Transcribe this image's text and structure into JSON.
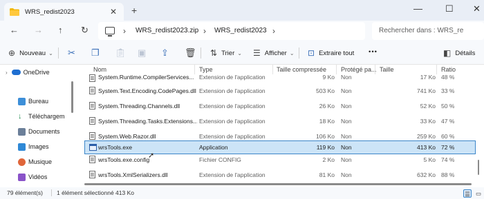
{
  "window": {
    "tab_title": "WRS_redist2023",
    "tab_close_glyph": "✕",
    "new_tab_glyph": "+",
    "minimize_glyph": "—",
    "maximize_glyph": "☐",
    "close_glyph": "✕"
  },
  "nav": {
    "back_glyph": "←",
    "forward_glyph": "→",
    "up_glyph": "↑",
    "refresh_glyph": "↻"
  },
  "address": {
    "breadcrumbs": [
      "WRS_redist2023.zip",
      "WRS_redist2023"
    ],
    "separator": "›"
  },
  "search": {
    "placeholder": "Rechercher dans : WRS_re"
  },
  "toolbar": {
    "new_label": "Nouveau",
    "sort_label": "Trier",
    "view_label": "Afficher",
    "extract_label": "Extraire tout",
    "more_glyph": "•••",
    "details_label": "Détails"
  },
  "sidebar": {
    "items": [
      {
        "label": "OneDrive",
        "icon": "cloud-icon"
      },
      {
        "label": "Bureau",
        "icon": "desktop-icon"
      },
      {
        "label": "Téléchargem",
        "icon": "download-icon"
      },
      {
        "label": "Documents",
        "icon": "documents-icon"
      },
      {
        "label": "Images",
        "icon": "pictures-icon"
      },
      {
        "label": "Musique",
        "icon": "music-icon"
      },
      {
        "label": "Vidéos",
        "icon": "videos-icon"
      }
    ]
  },
  "columns": [
    "Nom",
    "Type",
    "Taille compressée",
    "Protégé pa...",
    "Taille",
    "Ratio"
  ],
  "files": [
    {
      "name": "System.Runtime.CompilerServices...",
      "type": "Extension de l'application",
      "compressed": "9 Ko",
      "protected": "Non",
      "size": "17 Ko",
      "ratio": "48 %",
      "icon": "file-icon"
    },
    {
      "name": "System.Text.Encoding.CodePages.dll",
      "type": "Extension de l'application",
      "compressed": "503 Ko",
      "protected": "Non",
      "size": "741 Ko",
      "ratio": "33 %",
      "icon": "file-icon"
    },
    {
      "name": "System.Threading.Channels.dll",
      "type": "Extension de l'application",
      "compressed": "26 Ko",
      "protected": "Non",
      "size": "52 Ko",
      "ratio": "50 %",
      "icon": "file-icon"
    },
    {
      "name": "System.Threading.Tasks.Extensions...",
      "type": "Extension de l'application",
      "compressed": "18 Ko",
      "protected": "Non",
      "size": "33 Ko",
      "ratio": "47 %",
      "icon": "file-icon"
    },
    {
      "name": "System.Web.Razor.dll",
      "type": "Extension de l'application",
      "compressed": "106 Ko",
      "protected": "Non",
      "size": "259 Ko",
      "ratio": "60 %",
      "icon": "file-icon"
    },
    {
      "name": "wrsTools.exe",
      "type": "Application",
      "compressed": "119 Ko",
      "protected": "Non",
      "size": "413 Ko",
      "ratio": "72 %",
      "icon": "exe-icon",
      "selected": true
    },
    {
      "name": "wrsTools.exe.config",
      "type": "Fichier CONFIG",
      "compressed": "2 Ko",
      "protected": "Non",
      "size": "5 Ko",
      "ratio": "74 %",
      "icon": "file-icon"
    },
    {
      "name": "wrsTools.XmlSerializers.dll",
      "type": "Extension de l'application",
      "compressed": "81 Ko",
      "protected": "Non",
      "size": "632 Ko",
      "ratio": "88 %",
      "icon": "file-icon"
    }
  ],
  "status": {
    "item_count": "79 élément(s)",
    "selection": "1 élément sélectionné  413 Ko"
  },
  "colors": {
    "selection_bg": "#cce4f7",
    "selection_border": "#3b86c9",
    "folder": "#f2b705",
    "onedrive": "#1f6fd1"
  }
}
